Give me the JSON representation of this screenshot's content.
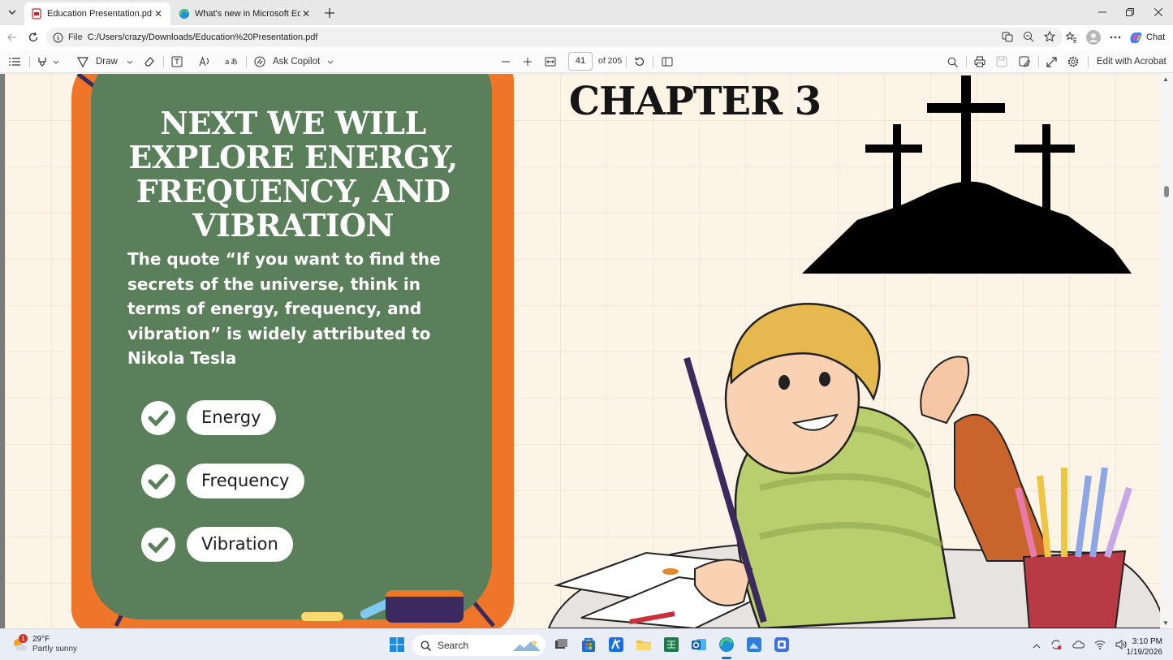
{
  "browser": {
    "tabs": [
      {
        "title": "Education Presentation.pdf",
        "active": true
      },
      {
        "title": "What's new in Microsoft Edge",
        "active": false
      }
    ],
    "address": {
      "scheme": "File",
      "url": "C:/Users/crazy/Downloads/Education%20Presentation.pdf"
    },
    "chat_label": "Chat"
  },
  "pdf_toolbar": {
    "draw_label": "Draw",
    "ask_copilot_label": "Ask Copilot",
    "page_current": "41",
    "page_total": "of 205",
    "edit_label": "Edit with Acrobat"
  },
  "slide": {
    "board_title": "NEXT WE WILL EXPLORE ENERGY, FREQUENCY, AND VIBRATION",
    "quote": "The quote “If you want to find the secrets of the universe, think in terms of energy, frequency, and vibration” is widely attributed to Nikola Tesla",
    "items": [
      "Energy",
      "Frequency",
      "Vibration"
    ],
    "chapter_title": "CHAPTER 3"
  },
  "taskbar": {
    "weather_temp": "29°F",
    "weather_desc": "Partly sunny",
    "weather_badge": "1",
    "search_placeholder": "Search",
    "time": "3:10 PM",
    "date": "1/19/2026"
  },
  "colors": {
    "board_green": "#5a7f5a",
    "board_frame": "#ef7628",
    "page_bg": "#fdf4e8"
  }
}
